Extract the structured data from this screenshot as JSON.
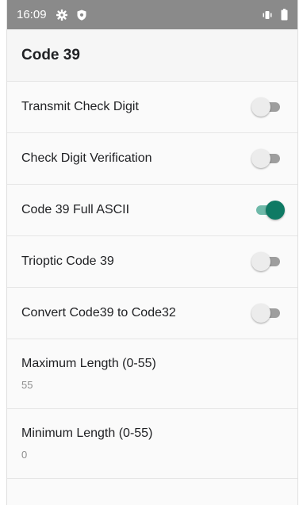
{
  "status_bar": {
    "time": "16:09",
    "left_icons": [
      "gear-icon",
      "shield-icon"
    ],
    "right_icons": [
      "vibrate-icon",
      "battery-icon"
    ]
  },
  "app_bar": {
    "title": "Code 39"
  },
  "settings": [
    {
      "label": "Transmit Check Digit",
      "checked": false
    },
    {
      "label": "Check Digit Verification",
      "checked": false
    },
    {
      "label": "Code 39 Full ASCII",
      "checked": true
    },
    {
      "label": "Trioptic Code 39",
      "checked": false
    },
    {
      "label": "Convert Code39 to Code32",
      "checked": false
    }
  ],
  "lengths": [
    {
      "label": "Maximum Length (0-55)",
      "value": "55"
    },
    {
      "label": "Minimum Length (0-55)",
      "value": "0"
    }
  ],
  "colors": {
    "status_bar_bg": "#8a8a8a",
    "switch_on_thumb": "#0f7a64",
    "switch_on_track": "#6fb9a9",
    "switch_off_track": "#9e9e9e"
  }
}
